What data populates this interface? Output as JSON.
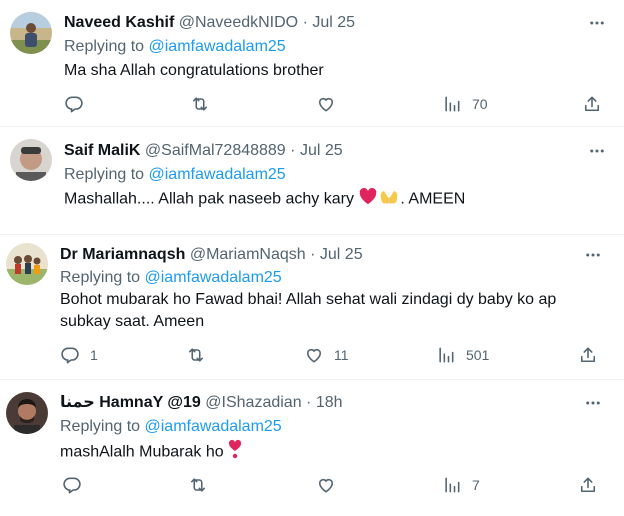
{
  "tweets": [
    {
      "name": "Naveed Kashif",
      "handle": "@NaveedkNIDO",
      "sep": "·",
      "date": "Jul 25",
      "replying_prefix": "Replying to",
      "replying_to": "@iamfawadalam25",
      "text": "Ma sha Allah congratulations brother",
      "reply_count": "",
      "retweet_count": "",
      "like_count": "",
      "view_count": "70"
    },
    {
      "name": "Saif MaliK",
      "handle": "@SaifMal72848889",
      "sep": "·",
      "date": "Jul 25",
      "replying_prefix": "Replying to",
      "replying_to": "@iamfawadalam25",
      "text_before": "Mashallah.... Allah pak naseeb achy kary",
      "text_after": ". AMEEN",
      "emojis": [
        "red-heart",
        "palms-up-together"
      ]
    },
    {
      "name": "Dr Mariamnaqsh",
      "handle": "@MariamNaqsh",
      "sep": "·",
      "date": "Jul 25",
      "replying_prefix": "Replying to",
      "replying_to": "@iamfawadalam25",
      "text_line1": "Bohot mubarak ho Fawad bhai! Allah sehat wali zindagi dy baby ko ap",
      "text_line2": "subkay saat. Ameen",
      "reply_count": "1",
      "retweet_count": "",
      "like_count": "11",
      "view_count": "501"
    },
    {
      "name": "حمنا HamnaY @19",
      "handle": "@IShazadian",
      "sep": "·",
      "date": "18h",
      "replying_prefix": "Replying to",
      "replying_to": "@iamfawadalam25",
      "text": "mashAlalh Mubarak ho",
      "emoji": "heart-exclamation",
      "reply_count": "",
      "retweet_count": "",
      "like_count": "",
      "view_count": "7"
    }
  ],
  "icons": [
    "reply-icon",
    "retweet-icon",
    "like-icon",
    "views-icon",
    "share-icon",
    "more-icon"
  ],
  "colors": {
    "link": "#1d9bf0",
    "secondary": "#536471",
    "text": "#0f1419",
    "divider": "#eff3f4",
    "heart": "#e0245e"
  }
}
